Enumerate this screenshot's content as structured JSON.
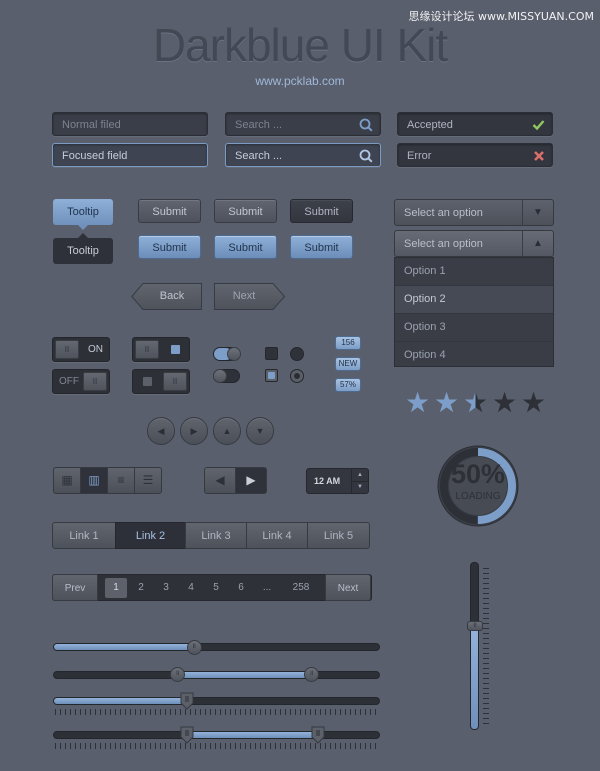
{
  "watermark": "思缘设计论坛 www.MISSYUAN.COM",
  "header": {
    "title": "Darkblue UI Kit",
    "subtitle": "www.pcklab.com"
  },
  "inputs": {
    "normal": "Normal filed",
    "focused": "Focused field",
    "search1": "Search ...",
    "search2": "Search ...",
    "accepted": "Accepted",
    "error": "Error"
  },
  "icons": {
    "search": "search-icon",
    "check": "check-icon",
    "cross": "cross-icon"
  },
  "tooltips": {
    "t1": "Tooltip",
    "t2": "Tooltip"
  },
  "buttons": {
    "submit": "Submit",
    "back": "Back",
    "next": "Next"
  },
  "select": {
    "placeholder": "Select an option",
    "options": [
      "Option 1",
      "Option 2",
      "Option 3",
      "Option 4"
    ],
    "selected_index": 1
  },
  "toggles": {
    "on": "ON",
    "off": "OFF"
  },
  "badges": [
    "156",
    "NEW",
    "57%"
  ],
  "rating": {
    "value": 2.5,
    "max": 5
  },
  "progress": {
    "value": 50,
    "label": "50%",
    "caption": "LOADING"
  },
  "time": {
    "value": "12 AM"
  },
  "links": [
    "Link 1",
    "Link 2",
    "Link 3",
    "Link 4",
    "Link 5"
  ],
  "links_active": 1,
  "pagination": {
    "prev": "Prev",
    "next": "Next",
    "pages": [
      "1",
      "2",
      "3",
      "4",
      "5",
      "6",
      "...",
      "258"
    ],
    "current": 0
  },
  "sliders": {
    "single": 0.43,
    "range": [
      0.38,
      0.79
    ],
    "ticked_single": 0.41,
    "ticked_range": [
      0.41,
      0.81
    ],
    "vertical": 0.62
  },
  "colors": {
    "accent": "#7c9ec8",
    "background": "#5a5f6d",
    "success": "#8fc862",
    "error": "#d9706a"
  }
}
